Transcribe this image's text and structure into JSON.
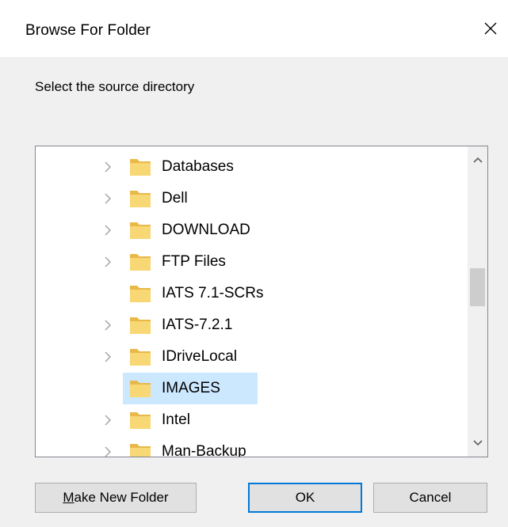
{
  "window": {
    "title": "Browse For Folder",
    "close_icon": "close-icon"
  },
  "prompt": "Select the source directory",
  "tree": {
    "items": [
      {
        "label": "Databases",
        "has_children": true,
        "selected": false
      },
      {
        "label": "Dell",
        "has_children": true,
        "selected": false
      },
      {
        "label": "DOWNLOAD",
        "has_children": true,
        "selected": false
      },
      {
        "label": "FTP Files",
        "has_children": true,
        "selected": false
      },
      {
        "label": "IATS 7.1-SCRs",
        "has_children": false,
        "selected": false
      },
      {
        "label": "IATS-7.2.1",
        "has_children": true,
        "selected": false
      },
      {
        "label": "IDriveLocal",
        "has_children": true,
        "selected": false
      },
      {
        "label": "IMAGES",
        "has_children": false,
        "selected": true
      },
      {
        "label": "Intel",
        "has_children": true,
        "selected": false
      },
      {
        "label": "Man-Backup",
        "has_children": true,
        "selected": false
      }
    ],
    "folder_color": "#f8d775",
    "selection_color": "#cce8ff"
  },
  "buttons": {
    "make_new_folder_prefix": "M",
    "make_new_folder_rest": "ake New Folder",
    "ok": "OK",
    "cancel": "Cancel"
  }
}
